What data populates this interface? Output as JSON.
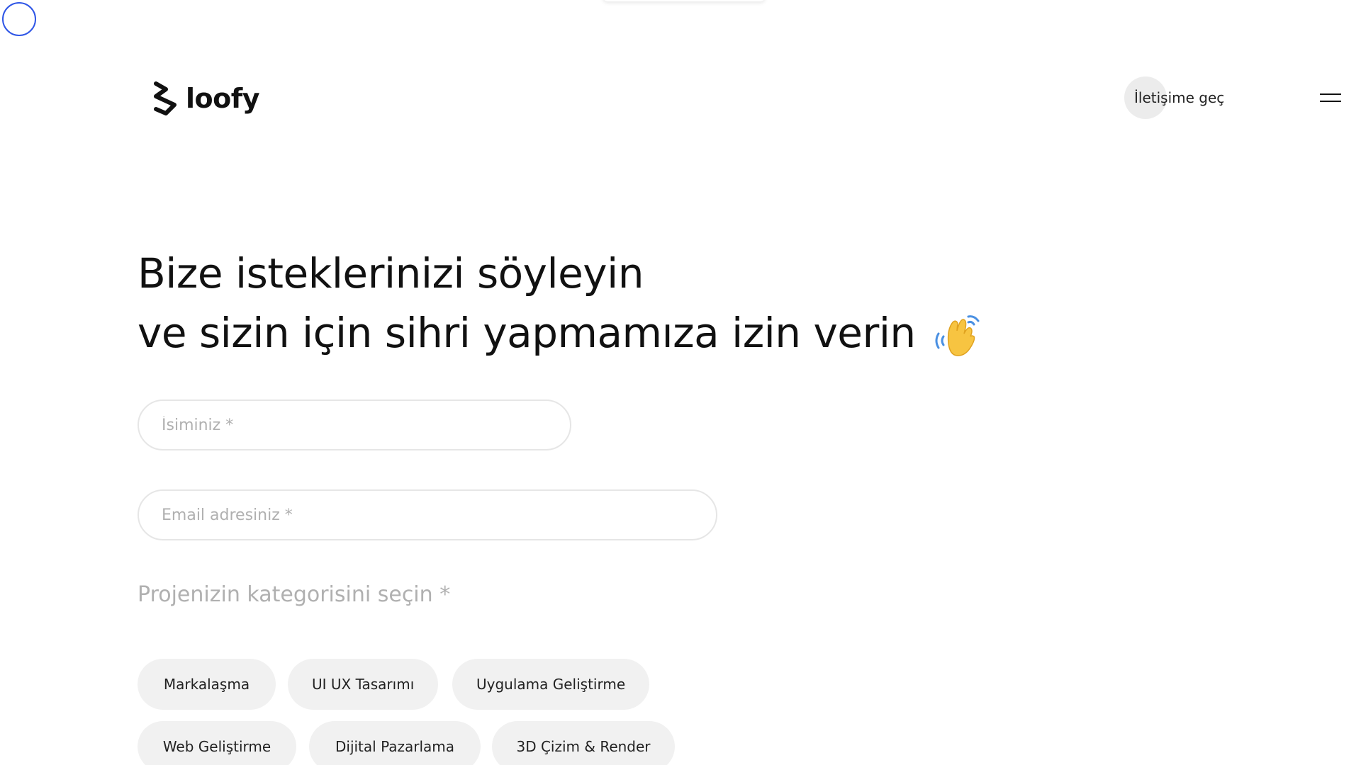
{
  "header": {
    "logo_text": "loofy",
    "contact_label": "İletişime geç",
    "icons": {
      "logo": "loofy-logo-mark",
      "menu": "hamburger-menu-icon"
    }
  },
  "hero": {
    "headline_line1": "Bize isteklerinizi söyleyin",
    "headline_line2": "ve sizin için sihri yapmamıza izin verin",
    "emoji_icon": "waving-hand-emoji"
  },
  "form": {
    "name_placeholder": "İsiminiz *",
    "email_placeholder": "Email adresiniz *",
    "category_label": "Projenizin kategorisini seçin *",
    "categories": [
      "Markalaşma",
      "UI UX Tasarımı",
      "Uygulama Geliştirme",
      "Web Geliştirme",
      "Dijital Pazarlama",
      "3D Çizim & Render"
    ]
  },
  "colors": {
    "accent_cursor": "#2f56e6",
    "chip_bg": "#f1f1f1",
    "placeholder": "#b0b0b0",
    "text": "#111111"
  }
}
